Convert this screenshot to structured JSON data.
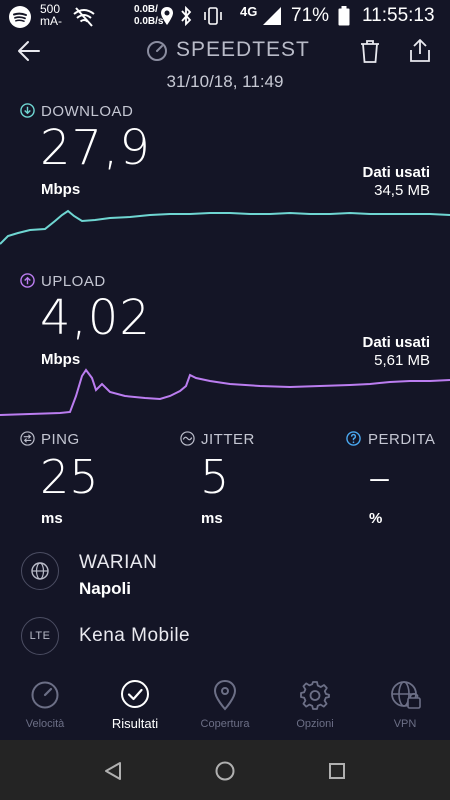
{
  "status_bar": {
    "speed_value": "500",
    "speed_unit": "mA-",
    "rate_top": "0.0B/",
    "rate_bottom": "0.0B/s",
    "network": "4G",
    "battery": "71%",
    "time": "11:55:13"
  },
  "header": {
    "title": "SPEEDTEST",
    "date": "31/10/18, 11:49"
  },
  "download": {
    "label": "DOWNLOAD",
    "value": "27,9",
    "unit": "Mbps",
    "data_used_label": "Dati usati",
    "data_used_value": "34,5 MB",
    "color": "#6fd6d2"
  },
  "upload": {
    "label": "UPLOAD",
    "value": "4,02",
    "unit": "Mbps",
    "data_used_label": "Dati usati",
    "data_used_value": "5,61 MB",
    "color": "#bb7df0"
  },
  "stats": {
    "ping": {
      "label": "PING",
      "value": "25",
      "unit": "ms"
    },
    "jitter": {
      "label": "JITTER",
      "value": "5",
      "unit": "ms"
    },
    "loss": {
      "label": "PERDITA",
      "value": "–",
      "unit": "%"
    }
  },
  "server": {
    "name": "WARIAN",
    "city": "Napoli"
  },
  "provider": {
    "badge": "LTE",
    "name": "Kena Mobile"
  },
  "nav": {
    "items": [
      {
        "label": "Velocità",
        "icon": "speedometer-icon"
      },
      {
        "label": "Risultati",
        "icon": "check-circle-icon"
      },
      {
        "label": "Copertura",
        "icon": "map-pin-icon"
      },
      {
        "label": "Opzioni",
        "icon": "gear-icon"
      },
      {
        "label": "VPN",
        "icon": "vpn-globe-icon"
      }
    ],
    "active_index": 1
  }
}
